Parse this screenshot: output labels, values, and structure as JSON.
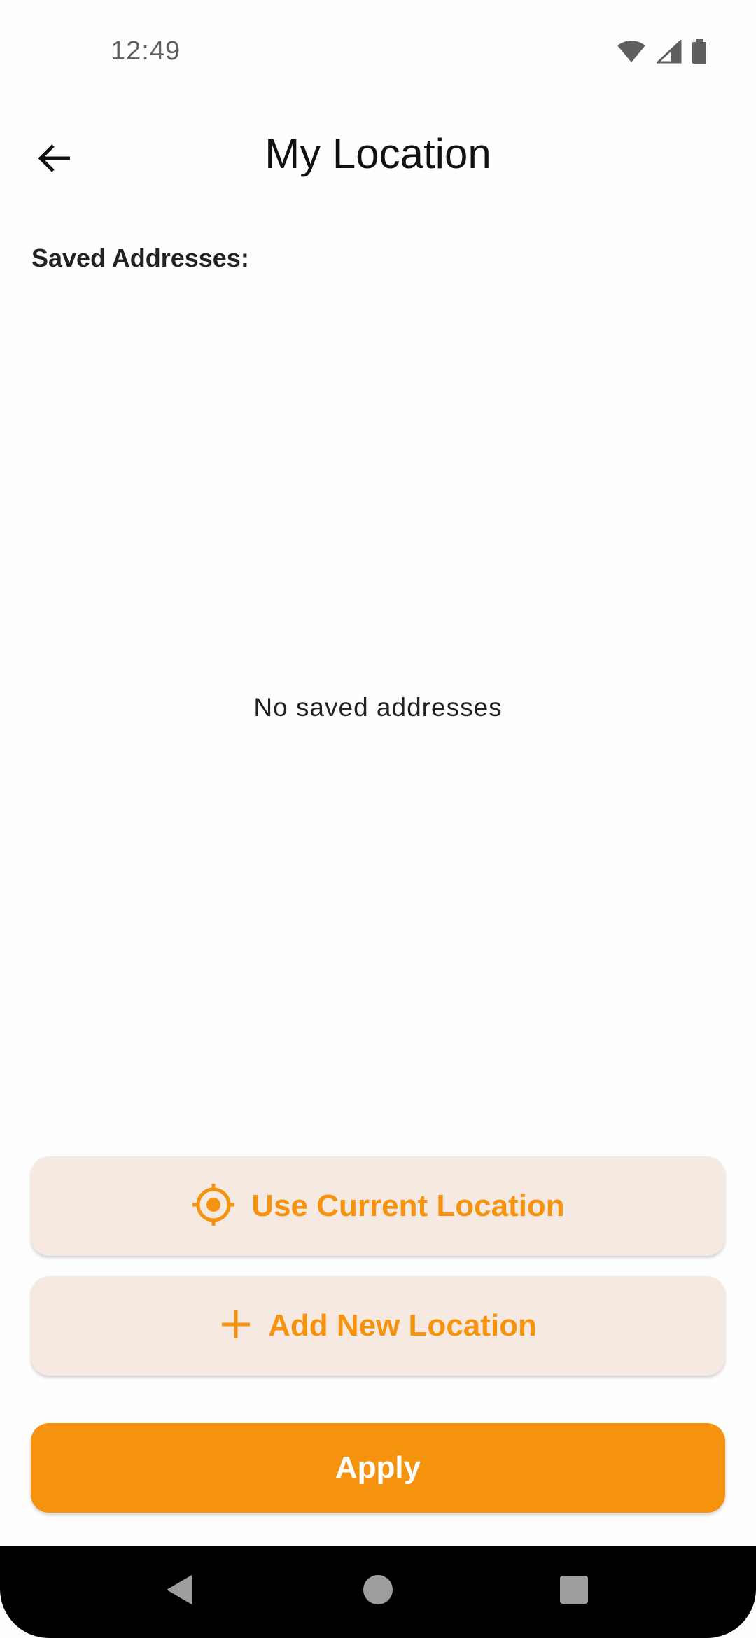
{
  "status_bar": {
    "time": "12:49",
    "icons": [
      "wifi-icon",
      "signal-icon",
      "battery-icon"
    ]
  },
  "app_bar": {
    "back_icon": "arrow-back-icon",
    "title": "My Location"
  },
  "saved_section": {
    "label": "Saved Addresses:",
    "empty_message": "No saved addresses"
  },
  "actions": {
    "use_current_location": {
      "icon": "crosshair-location-icon",
      "label": "Use Current Location"
    },
    "add_new_location": {
      "icon": "plus-icon",
      "label": "Add New Location"
    },
    "apply": {
      "label": "Apply"
    }
  },
  "navigation_bar": {
    "buttons": [
      "nav-back-icon",
      "nav-home-icon",
      "nav-recents-icon"
    ]
  },
  "colors": {
    "accent": "#f5930f",
    "tonal_background": "#f6e9e2",
    "text_primary": "#111111",
    "nav_background": "#000000"
  }
}
